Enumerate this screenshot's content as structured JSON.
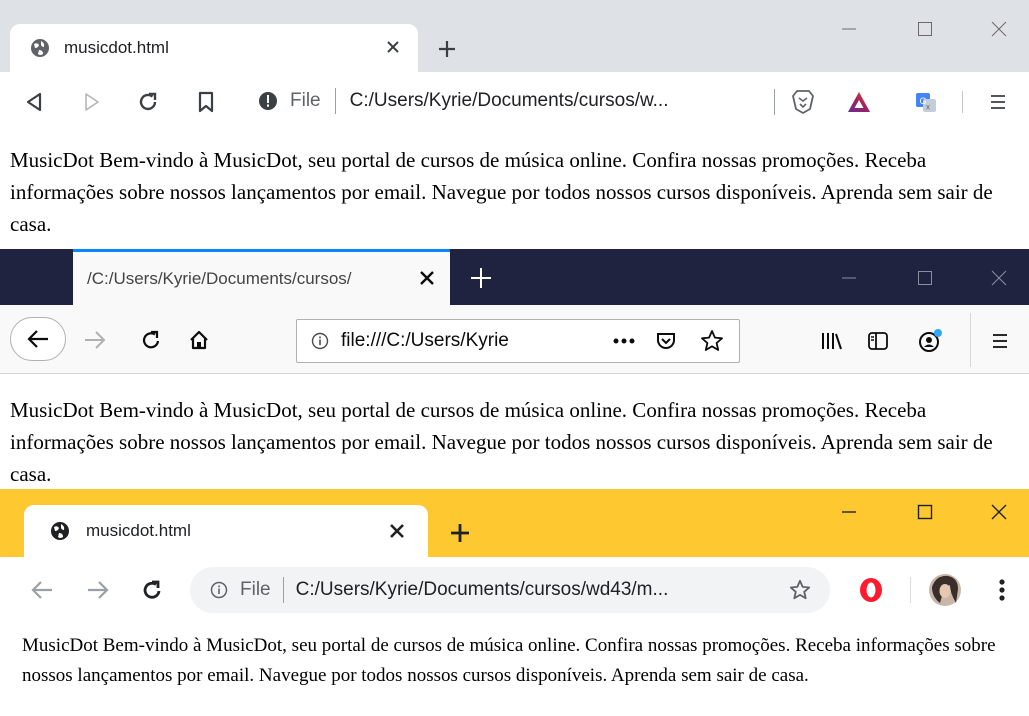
{
  "page_text": "MusicDot Bem-vindo à MusicDot, seu portal de cursos de música online. Confira nossas promoções. Receba informações sobre nossos lançamentos por email. Navegue por todos nossos cursos disponíveis. Aprenda sem sair de casa.",
  "brave": {
    "tab_title": "musicdot.html",
    "url_scheme": "File",
    "url": "C:/Users/Kyrie/Documents/cursos/w...",
    "colors": {
      "titlebar": "#dee1e6",
      "toolbar": "#ffffff",
      "brave_lion": "#fb542b"
    }
  },
  "firefox": {
    "tab_title": "/C:/Users/Kyrie/Documents/cursos/",
    "url": "file:///C:/Users/Kyrie",
    "colors": {
      "titlebar": "#202340",
      "tab_accent": "#0a84ff",
      "toolbar": "#f9f9fa"
    }
  },
  "chrome": {
    "tab_title": "musicdot.html",
    "url_scheme": "File",
    "url": "C:/Users/Kyrie/Documents/cursos/wd43/m...",
    "colors": {
      "titlebar": "#fdc830",
      "toolbar": "#ffffff",
      "omnibox": "#f1f3f4",
      "opera": "#ff1b2d"
    }
  }
}
